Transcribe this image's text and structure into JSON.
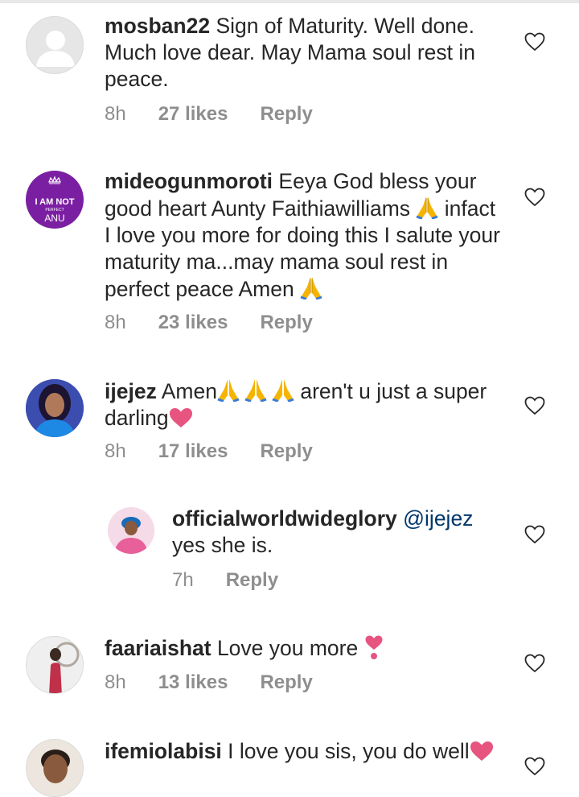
{
  "comments": [
    {
      "username": "mosban22",
      "text": " Sign of Maturity.  Well done. Much love dear. May Mama soul rest in peace.",
      "time": "8h",
      "likes": "27 likes",
      "reply": "Reply",
      "avatar": "default-avatar"
    },
    {
      "username": "mideogunmoroti",
      "text_a": " Eeya God bless your good heart Aunty Faithiawilliams ",
      "text_b": " infact I love you more for doing this I salute your maturity ma...may mama soul rest in perfect peace Amen ",
      "time": "8h",
      "likes": "23 likes",
      "reply": "Reply",
      "avatar_lines": [
        "I AM NOT",
        "PERFECT",
        "ANU"
      ],
      "avatar_color": "#7b1fa2"
    },
    {
      "username": "ijejez",
      "text_a": " Amen",
      "text_b": " aren't u just a super darling",
      "time": "8h",
      "likes": "17 likes",
      "reply": "Reply"
    },
    {
      "username": "officialworldwideglory",
      "mention": "@ijejez",
      "text": "yes she is.",
      "time": "7h",
      "reply": "Reply"
    },
    {
      "username": "faariaishat",
      "text": " Love you more ",
      "time": "8h",
      "likes": "13 likes",
      "reply": "Reply"
    },
    {
      "username": "ifemiolabisi",
      "text": " I love you sis, you do well"
    }
  ],
  "colors": {
    "text": "#262626",
    "meta": "#8e8e8e",
    "mention": "#00376b",
    "heart_emoji": "#e75480",
    "pray_emoji": "#f5b400"
  },
  "icons": {
    "like": "heart-outline-icon",
    "pray": "folded-hands-emoji",
    "heart": "pink-heart-emoji",
    "exclamation_heart": "heart-exclamation-emoji"
  }
}
